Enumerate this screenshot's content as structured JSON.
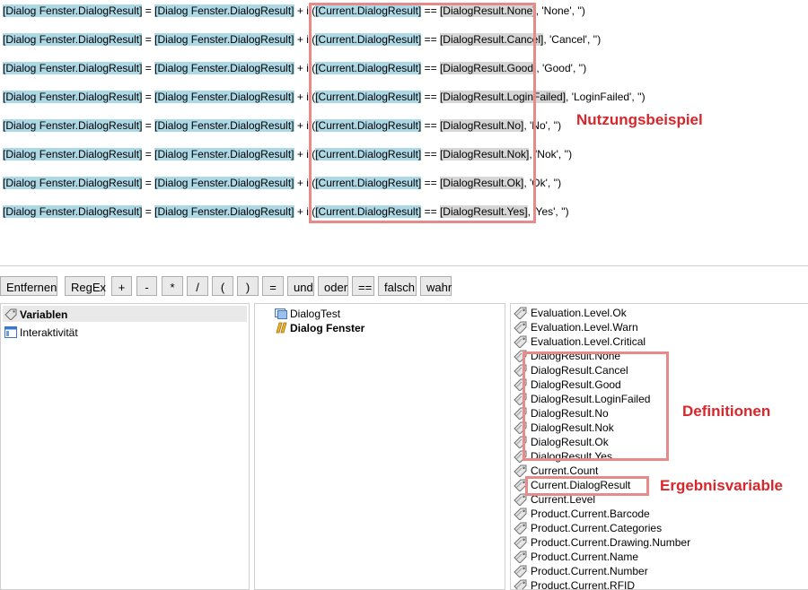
{
  "expressions": {
    "lines": [
      {
        "target": "[Dialog Fenster.DialogResult]",
        "eq": " = ",
        "source": "[Dialog Fenster.DialogResult]",
        "plus": " + if(",
        "current": "[Current.DialogResult]",
        "op": " == ",
        "def": "[DialogResult.None]",
        "result": ", 'None', '')"
      },
      {
        "target": "[Dialog Fenster.DialogResult]",
        "eq": " = ",
        "source": "[Dialog Fenster.DialogResult]",
        "plus": " + if(",
        "current": "[Current.DialogResult]",
        "op": " == ",
        "def": "[DialogResult.Cancel]",
        "result": ", 'Cancel', '')"
      },
      {
        "target": "[Dialog Fenster.DialogResult]",
        "eq": " = ",
        "source": "[Dialog Fenster.DialogResult]",
        "plus": " + if(",
        "current": "[Current.DialogResult]",
        "op": " == ",
        "def": "[DialogResult.Good]",
        "result": ", 'Good', '')"
      },
      {
        "target": "[Dialog Fenster.DialogResult]",
        "eq": " = ",
        "source": "[Dialog Fenster.DialogResult]",
        "plus": " + if(",
        "current": "[Current.DialogResult]",
        "op": " == ",
        "def": "[DialogResult.LoginFailed]",
        "result": ", 'LoginFailed', '')"
      },
      {
        "target": "[Dialog Fenster.DialogResult]",
        "eq": " = ",
        "source": "[Dialog Fenster.DialogResult]",
        "plus": " + if(",
        "current": "[Current.DialogResult]",
        "op": " == ",
        "def": "[DialogResult.No]",
        "result": ", 'No', '')"
      },
      {
        "target": "[Dialog Fenster.DialogResult]",
        "eq": " = ",
        "source": "[Dialog Fenster.DialogResult]",
        "plus": " + if(",
        "current": "[Current.DialogResult]",
        "op": " == ",
        "def": "[DialogResult.Nok]",
        "result": ", 'Nok', '')"
      },
      {
        "target": "[Dialog Fenster.DialogResult]",
        "eq": " = ",
        "source": "[Dialog Fenster.DialogResult]",
        "plus": " + if(",
        "current": "[Current.DialogResult]",
        "op": " == ",
        "def": "[DialogResult.Ok]",
        "result": ", 'Ok', '')"
      },
      {
        "target": "[Dialog Fenster.DialogResult]",
        "eq": " = ",
        "source": "[Dialog Fenster.DialogResult]",
        "plus": " + if(",
        "current": "[Current.DialogResult]",
        "op": " == ",
        "def": "[DialogResult.Yes]",
        "result": ", 'Yes', '')"
      }
    ]
  },
  "annotations": {
    "usage_example": "Nutzungsbeispiel",
    "definitions": "Definitionen",
    "result_variable": "Ergebnisvariable",
    "accent_color": "#d8262b",
    "box_color": "#e88a8a"
  },
  "toolbar": {
    "remove": "Entfernen",
    "regex": "RegEx",
    "plus": "+",
    "minus": "-",
    "multiply": "*",
    "divide": "/",
    "open_paren": "(",
    "close_paren": ")",
    "assign": "=",
    "and": "und",
    "or": "oder",
    "equals": "==",
    "false": "falsch",
    "true": "wahr"
  },
  "categories": {
    "items": [
      {
        "label": "Variablen",
        "icon": "tag-icon",
        "selected": true
      },
      {
        "label": "Interaktivität",
        "icon": "window-icon",
        "selected": false
      }
    ]
  },
  "objects": {
    "items": [
      {
        "label": "DialogTest",
        "icon": "project-icon"
      },
      {
        "label": "Dialog Fenster",
        "icon": "dialog-icon"
      }
    ]
  },
  "variables": {
    "items": [
      "Evaluation.Level.Ok",
      "Evaluation.Level.Warn",
      "Evaluation.Level.Critical",
      "DialogResult.None",
      "DialogResult.Cancel",
      "DialogResult.Good",
      "DialogResult.LoginFailed",
      "DialogResult.No",
      "DialogResult.Nok",
      "DialogResult.Ok",
      "DialogResult.Yes",
      "Current.Count",
      "Current.DialogResult",
      "Current.Level",
      "Product.Current.Barcode",
      "Product.Current.Categories",
      "Product.Current.Drawing.Number",
      "Product.Current.Name",
      "Product.Current.Number",
      "Product.Current.RFID"
    ]
  }
}
